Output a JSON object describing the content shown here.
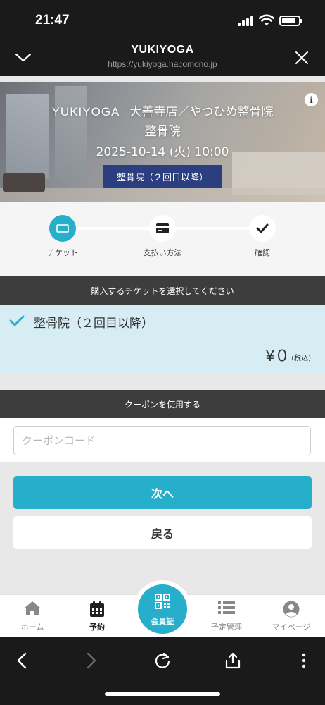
{
  "status_bar": {
    "time": "21:47",
    "battery_level": 0.85
  },
  "browser": {
    "site_title": "YUKIYOGA",
    "url": "https://yukiyoga.hacomono.jp"
  },
  "hero": {
    "brand": "YUKIYOGA",
    "store": "大善寺店／やつひめ整骨院",
    "category": "整骨院",
    "datetime": "2025-10-14 (火)  10:00",
    "badge": "整骨院（２回目以降）",
    "info_icon_glyph": "i"
  },
  "steps": [
    {
      "label": "チケット",
      "icon": "ticket-icon",
      "state": "active"
    },
    {
      "label": "支払い方法",
      "icon": "credit-card-icon",
      "state": "pending"
    },
    {
      "label": "確認",
      "icon": "checkmark-icon",
      "state": "pending"
    }
  ],
  "ticket_section": {
    "header": "購入するチケットを選択してください",
    "ticket_name": "整骨院（２回目以降）",
    "price": "¥０",
    "tax_note": "(税込)"
  },
  "coupon_section": {
    "header": "クーポンを使用する",
    "placeholder": "クーポンコード",
    "value": ""
  },
  "buttons": {
    "next": "次へ",
    "back": "戻る"
  },
  "tabbar": {
    "home": "ホーム",
    "reservation": "予約",
    "member_card": "会員証",
    "schedule": "予定管理",
    "mypage": "マイページ"
  },
  "colors": {
    "accent": "#27aecb",
    "badge": "#2b3f80",
    "dark": "#1a1a1a",
    "ticket_bg": "#d6edf4"
  }
}
